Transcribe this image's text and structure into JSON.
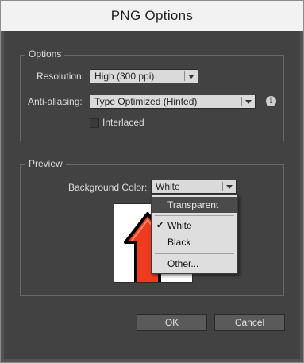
{
  "window": {
    "title": "PNG Options"
  },
  "options_group": {
    "title": "Options",
    "resolution_label": "Resolution:",
    "resolution_value": "High (300 ppi)",
    "antialiasing_label": "Anti-aliasing:",
    "antialiasing_value": "Type Optimized (Hinted)",
    "interlaced_label": "Interlaced",
    "interlaced_checked": false
  },
  "preview_group": {
    "title": "Preview",
    "bg_color_label": "Background Color:",
    "bg_color_value": "White"
  },
  "bg_dropdown": {
    "items": [
      {
        "label": "Transparent",
        "highlighted": true
      },
      {
        "label": "White",
        "selected": true
      },
      {
        "label": "Black"
      },
      {
        "label": "Other..."
      }
    ]
  },
  "buttons": {
    "ok": "OK",
    "cancel": "Cancel"
  },
  "colors": {
    "dialog_bg": "#424242",
    "arrow_fill": "#f03c1e",
    "arrow_stroke": "#000000",
    "menu_highlight": "#4b4b4b"
  },
  "icons": [
    "info-icon",
    "dropdown-arrow-icon",
    "checkmark-icon",
    "up-arrow-artwork"
  ]
}
